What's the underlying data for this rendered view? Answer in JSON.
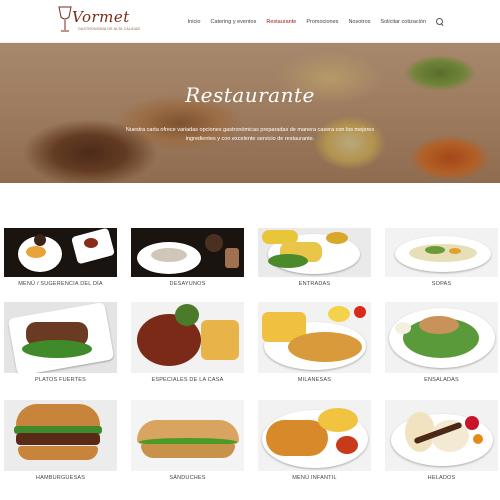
{
  "brand": {
    "name": "Vormet",
    "tagline": "GASTRONOMIA DE ALTA CALIDAD"
  },
  "nav": {
    "items": [
      {
        "label": "Inicio",
        "active": false
      },
      {
        "label": "Catering y eventos",
        "active": false
      },
      {
        "label": "Restaurante",
        "active": true
      },
      {
        "label": "Promociones",
        "active": false
      },
      {
        "label": "Nosotros",
        "active": false
      },
      {
        "label": "Solicitar cotización",
        "active": false
      }
    ],
    "search_icon": "search-icon"
  },
  "hero": {
    "title": "Restaurante",
    "text": "Nuestra carta ofrece variadas opciones gastronómicas preparadas de manera casera con los mejores ingredientes y con excelente servicio de restaurante."
  },
  "categories": [
    {
      "label": "MENÚ / SUGERENCIA DEL DÍA"
    },
    {
      "label": "DESAYUNOS"
    },
    {
      "label": "ENTRADAS"
    },
    {
      "label": "SOPAS"
    },
    {
      "label": "PLATOS FUERTES"
    },
    {
      "label": "ESPECIALES DE LA CASA"
    },
    {
      "label": "MILANESAS"
    },
    {
      "label": "ENSALADAS"
    },
    {
      "label": "HAMBURGUESAS"
    },
    {
      "label": "SÁNDUCHES"
    },
    {
      "label": "MENÚ INFANTIL"
    },
    {
      "label": "HELADOS"
    }
  ],
  "colors": {
    "accent": "#8b1a1a",
    "nav_text": "#444444"
  }
}
